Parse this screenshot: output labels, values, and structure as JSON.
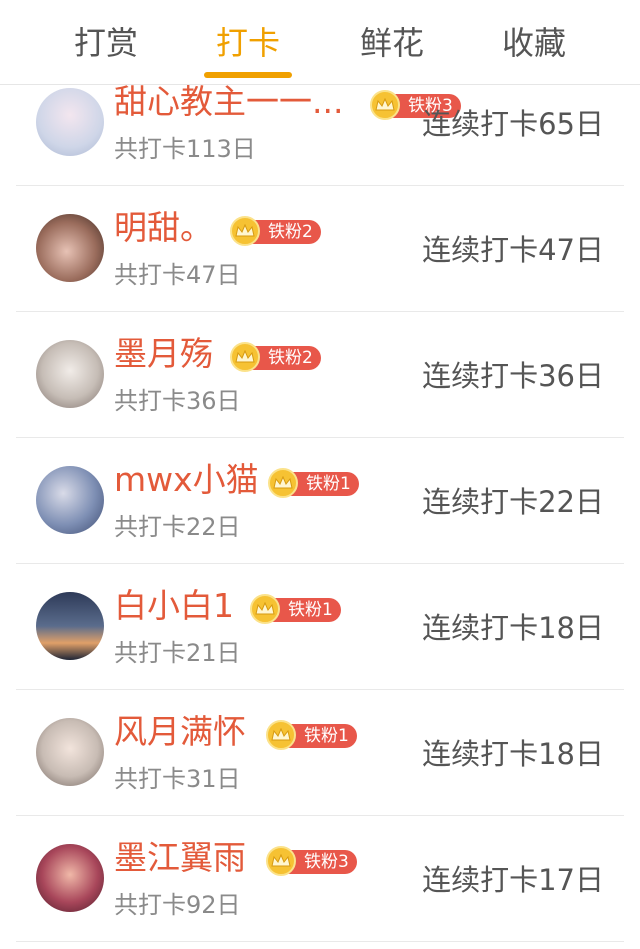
{
  "tabs": [
    {
      "label": "打赏",
      "active": false
    },
    {
      "label": "打卡",
      "active": true
    },
    {
      "label": "鲜花",
      "active": false
    },
    {
      "label": "收藏",
      "active": false
    }
  ],
  "accent_color": "#f0a000",
  "name_color": "#e35a3a",
  "badge_color": "#e8574a",
  "rows": [
    {
      "name": "甜心教主一一...",
      "badge": "铁粉3",
      "total": "共打卡113日",
      "streak": "连续打卡65日",
      "avatar_color": "#cfd6e8"
    },
    {
      "name": "明甜。",
      "badge": "铁粉2",
      "total": "共打卡47日",
      "streak": "连续打卡47日",
      "avatar_color": "#7a5a4c"
    },
    {
      "name": "墨月殇",
      "badge": "铁粉2",
      "total": "共打卡36日",
      "streak": "连续打卡36日",
      "avatar_color": "#b9b2ad"
    },
    {
      "name": "mwx小猫",
      "badge": "铁粉1",
      "total": "共打卡22日",
      "streak": "连续打卡22日",
      "avatar_color": "#6a7ea6"
    },
    {
      "name": "白小白1",
      "badge": "铁粉1",
      "total": "共打卡21日",
      "streak": "连续打卡18日",
      "avatar_color": "#3b4a66"
    },
    {
      "name": "风月满怀",
      "badge": "铁粉1",
      "total": "共打卡31日",
      "streak": "连续打卡18日",
      "avatar_color": "#c8bcb4"
    },
    {
      "name": "墨江翼雨",
      "badge": "铁粉3",
      "total": "共打卡92日",
      "streak": "连续打卡17日",
      "avatar_color": "#a8465a"
    }
  ]
}
